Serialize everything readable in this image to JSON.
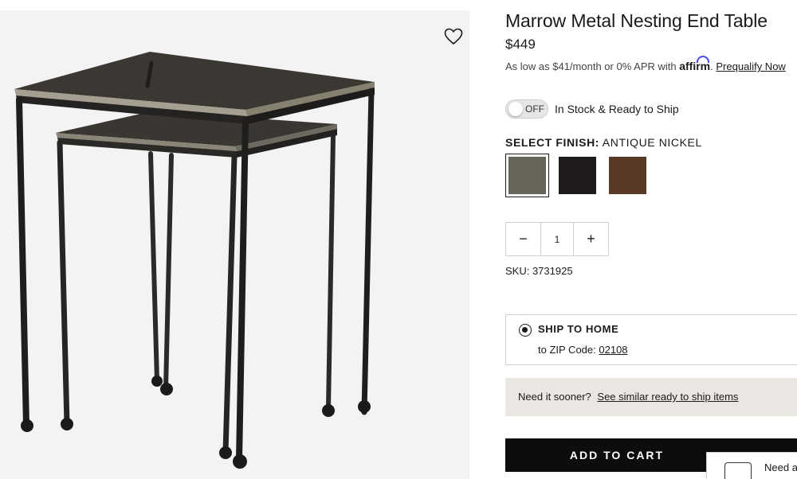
{
  "product": {
    "title": "Marrow Metal Nesting End Table",
    "price": "$449",
    "image_alt": "product-image"
  },
  "financing": {
    "prefix": "As low as $41/month or 0% APR with",
    "brand": "affirm",
    "link": "Prequalify Now"
  },
  "availability": {
    "toggle_state": "OFF",
    "text": "In Stock & Ready to Ship"
  },
  "finish": {
    "label": "SELECT FINISH:",
    "selected": "ANTIQUE NICKEL",
    "swatches": [
      {
        "name": "Antique Nickel",
        "color": "#67645a",
        "selected": true
      },
      {
        "name": "Black",
        "color": "#1e1b1a",
        "selected": false
      },
      {
        "name": "Bronze",
        "color": "#5a3a26",
        "selected": false
      }
    ]
  },
  "quantity": {
    "minus": "−",
    "value": "1",
    "plus": "+"
  },
  "sku": "SKU: 3731925",
  "shipping": {
    "title": "SHIP TO HOME",
    "zip_prefix": "to ZIP Code:",
    "zip": "02108"
  },
  "sooner": {
    "question": "Need it sooner?",
    "link": "See similar ready to ship items"
  },
  "cta": {
    "add_to_cart": "ADD TO CART"
  },
  "chat": {
    "label": "Need a"
  },
  "icons": {
    "wishlist": "heart-icon",
    "chat": "chat-icon"
  }
}
